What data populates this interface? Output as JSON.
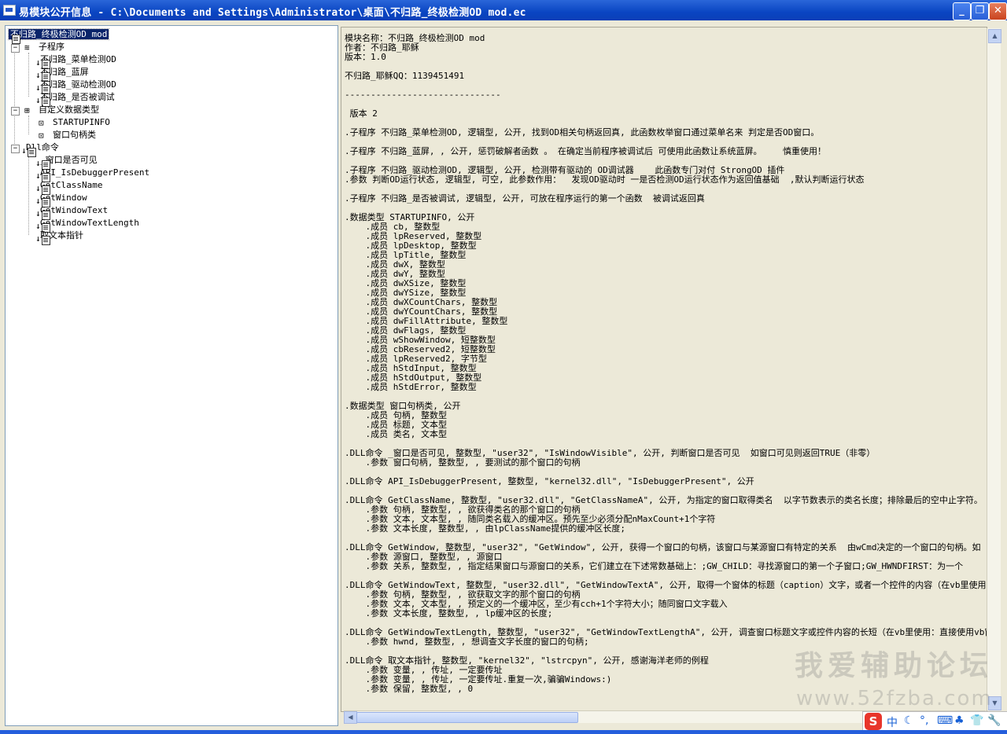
{
  "window": {
    "title": "易模块公开信息 - C:\\Documents and Settings\\Administrator\\桌面\\不归路_终极检测OD mod.ec"
  },
  "tree": {
    "root": "不归路_终极检测OD mod",
    "groups": [
      {
        "label": "子程序",
        "items": [
          "不归路_菜单检测OD",
          "不归路_蓝屏",
          "不归路_驱动检测OD",
          "不归路_是否被调试"
        ]
      },
      {
        "label": "自定义数据类型",
        "items": [
          "STARTUPINFO",
          "窗口句柄类"
        ]
      },
      {
        "label": "Dll命令",
        "items": [
          "_窗口是否可见",
          "API_IsDebuggerPresent",
          "GetClassName",
          "GetWindow",
          "GetWindowText",
          "GetWindowTextLength",
          "取文本指针"
        ]
      }
    ]
  },
  "content": {
    "text": "模块名称：不归路_终极检测OD mod\n作者：不归路_耶稣\n版本：1.0\n\n不归路_耶稣QQ：1139451491\n\n------------------------------\n\n 版本 2\n\n.子程序 不归路_菜单检测OD, 逻辑型, 公开, 找到OD相关句柄返回真, 此函数枚举窗口通过菜单名来 判定是否OD窗口。\n\n.子程序 不归路_蓝屏, , 公开, 惩罚破解者函数 。 在确定当前程序被调试后 可使用此函数让系统蓝屏。    慎重使用！\n\n.子程序 不归路_驱动检测OD, 逻辑型, 公开, 检测带有驱动的 OD调试器    此函数专门对付 StrongOD 插件\n.参数 判断OD运行状态, 逻辑型, 可空, 此参数作用：  发现OD驱动时 一是否检测OD运行状态作为返回值基础  ,默认判断运行状态\n\n.子程序 不归路_是否被调试, 逻辑型, 公开, 可放在程序运行的第一个函数  被调试返回真\n\n.数据类型 STARTUPINFO, 公开\n    .成员 cb, 整数型\n    .成员 lpReserved, 整数型\n    .成员 lpDesktop, 整数型\n    .成员 lpTitle, 整数型\n    .成员 dwX, 整数型\n    .成员 dwY, 整数型\n    .成员 dwXSize, 整数型\n    .成员 dwYSize, 整数型\n    .成员 dwXCountChars, 整数型\n    .成员 dwYCountChars, 整数型\n    .成员 dwFillAttribute, 整数型\n    .成员 dwFlags, 整数型\n    .成员 wShowWindow, 短整数型\n    .成员 cbReserved2, 短整数型\n    .成员 lpReserved2, 字节型\n    .成员 hStdInput, 整数型\n    .成员 hStdOutput, 整数型\n    .成员 hStdError, 整数型\n\n.数据类型 窗口句柄类, 公开\n    .成员 句柄, 整数型\n    .成员 标题, 文本型\n    .成员 类名, 文本型\n\n.DLL命令 _窗口是否可见, 整数型, \"user32\", \"IsWindowVisible\", 公开, 判断窗口是否可见  如窗口可见则返回TRUE（非零）\n    .参数 窗口句柄, 整数型, , 要测试的那个窗口的句柄\n\n.DLL命令 API_IsDebuggerPresent, 整数型, \"kernel32.dll\", \"IsDebuggerPresent\", 公开\n\n.DLL命令 GetClassName, 整数型, \"user32.dll\", \"GetClassNameA\", 公开, 为指定的窗口取得类名  以字节数表示的类名长度；排除最后的空中止字符。\n    .参数 句柄, 整数型, , 欲获得类名的那个窗口的句柄\n    .参数 文本, 文本型, , 随同类名载入的缓冲区。预先至少必须分配nMaxCount+1个字符\n    .参数 文本长度, 整数型, , 由lpClassName提供的缓冲区长度;\n\n.DLL命令 GetWindow, 整数型, \"user32\", \"GetWindow\", 公开, 获得一个窗口的句柄，该窗口与某源窗口有特定的关系  由wCmd决定的一个窗口的句柄。如\n    .参数 源窗口, 整数型, , 源窗口\n    .参数 关系, 整数型, , 指定结果窗口与源窗口的关系，它们建立在下述常数基础上：;GW_CHILD：寻找源窗口的第一个子窗口;GW_HWNDFIRST：为一个\n\n.DLL命令 GetWindowText, 整数型, \"user32.dll\", \"GetWindowTextA\", 公开, 取得一个窗体的标题（caption）文字，或者一个控件的内容（在vb里使用：\n    .参数 句柄, 整数型, , 欲获取文字的那个窗口的句柄\n    .参数 文本, 文本型, , 预定义的一个缓冲区，至少有cch+1个字符大小；随同窗口文字载入\n    .参数 文本长度, 整数型, , lp缓冲区的长度;\n\n.DLL命令 GetWindowTextLength, 整数型, \"user32\", \"GetWindowTextLengthA\", 公开, 调查窗口标题文字或控件内容的长短（在vb里使用：直接使用vb窗\n    .参数 hwnd, 整数型, , 想调查文字长度的窗口的句柄;\n\n.DLL命令 取文本指针, 整数型, \"kernel32\", \"lstrcpyn\", 公开, 感谢海洋老师的例程\n    .参数 变量, , 传址, 一定要传址\n    .参数 变量, , 传址, 一定要传址.重复一次,骗骗Windows:)\n    .参数 保留, 整数型, , 0"
  },
  "watermark": {
    "line1": "我爱辅助论坛",
    "line2": "www.52fzba.com"
  },
  "ime": {
    "logo": "S",
    "items": [
      "中",
      "☾",
      "°,",
      "⌨",
      "♣",
      "👕",
      "🔧"
    ]
  }
}
